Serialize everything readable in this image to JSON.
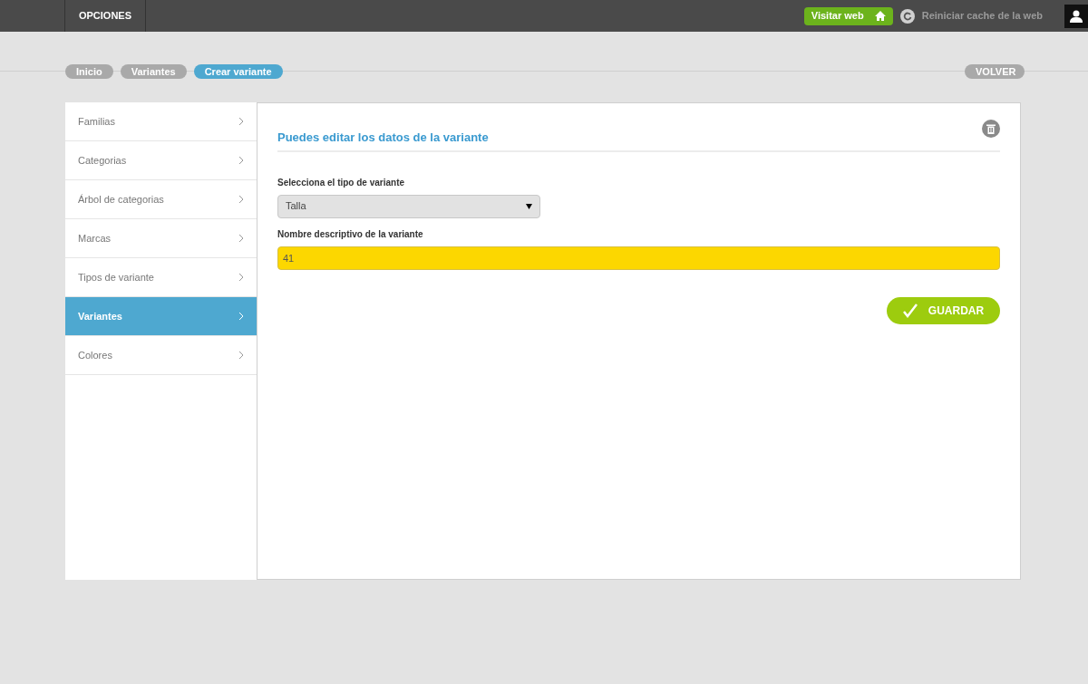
{
  "topbar": {
    "menu": "OPCIONES",
    "visit_button": "Visitar web",
    "cache_link": "Reiniciar cache de la web"
  },
  "breadcrumbs": [
    {
      "label": "Inicio",
      "selected": false
    },
    {
      "label": "Variantes",
      "selected": false
    },
    {
      "label": "Crear variante",
      "selected": true
    }
  ],
  "back_button": "VOLVER",
  "sidebar": {
    "items": [
      {
        "label": "Familias",
        "selected": false
      },
      {
        "label": "Categorias",
        "selected": false
      },
      {
        "label": "Árbol de categorias",
        "selected": false
      },
      {
        "label": "Marcas",
        "selected": false
      },
      {
        "label": "Tipos de variante",
        "selected": false
      },
      {
        "label": "Variantes",
        "selected": true
      },
      {
        "label": "Colores",
        "selected": false
      }
    ]
  },
  "form": {
    "title": "Puedes editar los datos de la variante",
    "type_label": "Selecciona el tipo de variante",
    "type_value": "Talla",
    "name_label": "Nombre descriptivo de la variante",
    "name_value": "41",
    "save_button": "GUARDAR"
  }
}
